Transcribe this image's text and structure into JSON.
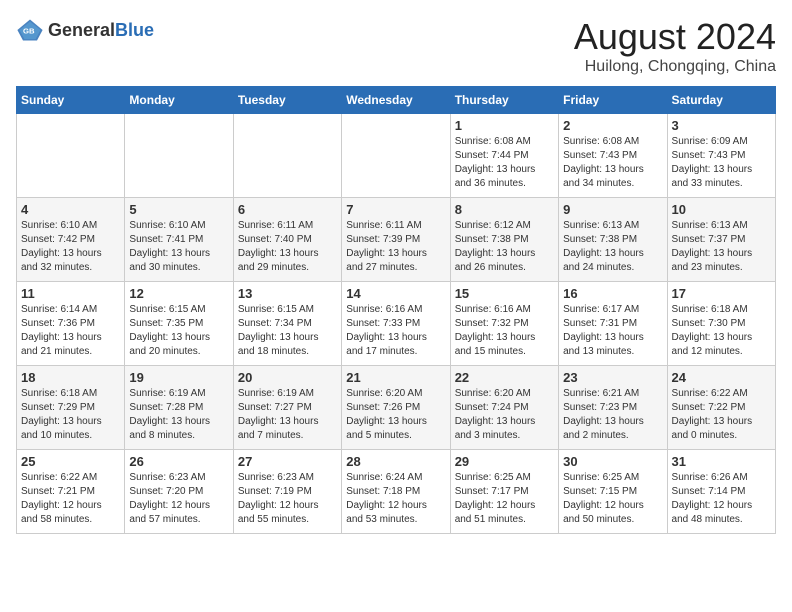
{
  "logo": {
    "general": "General",
    "blue": "Blue"
  },
  "title": "August 2024",
  "subtitle": "Huilong, Chongqing, China",
  "days_of_week": [
    "Sunday",
    "Monday",
    "Tuesday",
    "Wednesday",
    "Thursday",
    "Friday",
    "Saturday"
  ],
  "weeks": [
    [
      {
        "day": "",
        "info": ""
      },
      {
        "day": "",
        "info": ""
      },
      {
        "day": "",
        "info": ""
      },
      {
        "day": "",
        "info": ""
      },
      {
        "day": "1",
        "info": "Sunrise: 6:08 AM\nSunset: 7:44 PM\nDaylight: 13 hours and 36 minutes."
      },
      {
        "day": "2",
        "info": "Sunrise: 6:08 AM\nSunset: 7:43 PM\nDaylight: 13 hours and 34 minutes."
      },
      {
        "day": "3",
        "info": "Sunrise: 6:09 AM\nSunset: 7:43 PM\nDaylight: 13 hours and 33 minutes."
      }
    ],
    [
      {
        "day": "4",
        "info": "Sunrise: 6:10 AM\nSunset: 7:42 PM\nDaylight: 13 hours and 32 minutes."
      },
      {
        "day": "5",
        "info": "Sunrise: 6:10 AM\nSunset: 7:41 PM\nDaylight: 13 hours and 30 minutes."
      },
      {
        "day": "6",
        "info": "Sunrise: 6:11 AM\nSunset: 7:40 PM\nDaylight: 13 hours and 29 minutes."
      },
      {
        "day": "7",
        "info": "Sunrise: 6:11 AM\nSunset: 7:39 PM\nDaylight: 13 hours and 27 minutes."
      },
      {
        "day": "8",
        "info": "Sunrise: 6:12 AM\nSunset: 7:38 PM\nDaylight: 13 hours and 26 minutes."
      },
      {
        "day": "9",
        "info": "Sunrise: 6:13 AM\nSunset: 7:38 PM\nDaylight: 13 hours and 24 minutes."
      },
      {
        "day": "10",
        "info": "Sunrise: 6:13 AM\nSunset: 7:37 PM\nDaylight: 13 hours and 23 minutes."
      }
    ],
    [
      {
        "day": "11",
        "info": "Sunrise: 6:14 AM\nSunset: 7:36 PM\nDaylight: 13 hours and 21 minutes."
      },
      {
        "day": "12",
        "info": "Sunrise: 6:15 AM\nSunset: 7:35 PM\nDaylight: 13 hours and 20 minutes."
      },
      {
        "day": "13",
        "info": "Sunrise: 6:15 AM\nSunset: 7:34 PM\nDaylight: 13 hours and 18 minutes."
      },
      {
        "day": "14",
        "info": "Sunrise: 6:16 AM\nSunset: 7:33 PM\nDaylight: 13 hours and 17 minutes."
      },
      {
        "day": "15",
        "info": "Sunrise: 6:16 AM\nSunset: 7:32 PM\nDaylight: 13 hours and 15 minutes."
      },
      {
        "day": "16",
        "info": "Sunrise: 6:17 AM\nSunset: 7:31 PM\nDaylight: 13 hours and 13 minutes."
      },
      {
        "day": "17",
        "info": "Sunrise: 6:18 AM\nSunset: 7:30 PM\nDaylight: 13 hours and 12 minutes."
      }
    ],
    [
      {
        "day": "18",
        "info": "Sunrise: 6:18 AM\nSunset: 7:29 PM\nDaylight: 13 hours and 10 minutes."
      },
      {
        "day": "19",
        "info": "Sunrise: 6:19 AM\nSunset: 7:28 PM\nDaylight: 13 hours and 8 minutes."
      },
      {
        "day": "20",
        "info": "Sunrise: 6:19 AM\nSunset: 7:27 PM\nDaylight: 13 hours and 7 minutes."
      },
      {
        "day": "21",
        "info": "Sunrise: 6:20 AM\nSunset: 7:26 PM\nDaylight: 13 hours and 5 minutes."
      },
      {
        "day": "22",
        "info": "Sunrise: 6:20 AM\nSunset: 7:24 PM\nDaylight: 13 hours and 3 minutes."
      },
      {
        "day": "23",
        "info": "Sunrise: 6:21 AM\nSunset: 7:23 PM\nDaylight: 13 hours and 2 minutes."
      },
      {
        "day": "24",
        "info": "Sunrise: 6:22 AM\nSunset: 7:22 PM\nDaylight: 13 hours and 0 minutes."
      }
    ],
    [
      {
        "day": "25",
        "info": "Sunrise: 6:22 AM\nSunset: 7:21 PM\nDaylight: 12 hours and 58 minutes."
      },
      {
        "day": "26",
        "info": "Sunrise: 6:23 AM\nSunset: 7:20 PM\nDaylight: 12 hours and 57 minutes."
      },
      {
        "day": "27",
        "info": "Sunrise: 6:23 AM\nSunset: 7:19 PM\nDaylight: 12 hours and 55 minutes."
      },
      {
        "day": "28",
        "info": "Sunrise: 6:24 AM\nSunset: 7:18 PM\nDaylight: 12 hours and 53 minutes."
      },
      {
        "day": "29",
        "info": "Sunrise: 6:25 AM\nSunset: 7:17 PM\nDaylight: 12 hours and 51 minutes."
      },
      {
        "day": "30",
        "info": "Sunrise: 6:25 AM\nSunset: 7:15 PM\nDaylight: 12 hours and 50 minutes."
      },
      {
        "day": "31",
        "info": "Sunrise: 6:26 AM\nSunset: 7:14 PM\nDaylight: 12 hours and 48 minutes."
      }
    ]
  ]
}
